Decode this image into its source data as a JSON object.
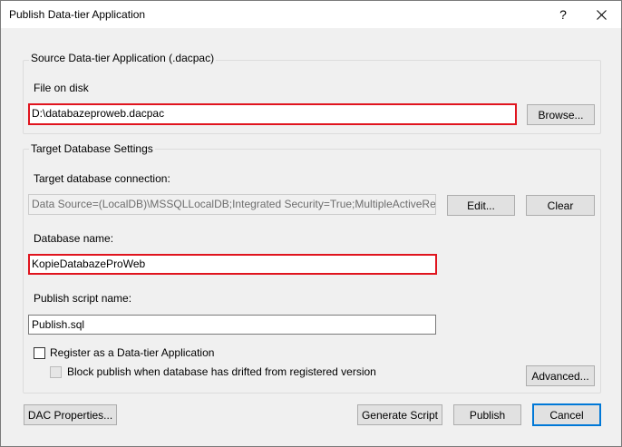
{
  "window": {
    "title": "Publish Data-tier Application",
    "help_glyph": "?"
  },
  "source": {
    "group_title": "Source Data-tier Application (.dacpac)",
    "file_label": "File on disk",
    "file_value": "D:\\databazeproweb.dacpac",
    "browse_label": "Browse..."
  },
  "target": {
    "group_title": "Target Database Settings",
    "connection_label": "Target database connection:",
    "connection_value": "Data Source=(LocalDB)\\MSSQLLocalDB;Integrated Security=True;MultipleActiveResu",
    "edit_label": "Edit...",
    "clear_label": "Clear",
    "dbname_label": "Database name:",
    "dbname_value": "KopieDatabazeProWeb",
    "script_label": "Publish script name:",
    "script_value": "Publish.sql",
    "register_label": "Register as a Data-tier Application",
    "register_checked": false,
    "block_label": "Block publish when database has drifted from registered version",
    "block_checked": false,
    "advanced_label": "Advanced..."
  },
  "footer": {
    "dac_properties_label": "DAC Properties...",
    "generate_script_label": "Generate Script",
    "publish_label": "Publish",
    "cancel_label": "Cancel"
  },
  "colors": {
    "highlight_border": "#e0141e",
    "default_button_border": "#0078d7"
  }
}
